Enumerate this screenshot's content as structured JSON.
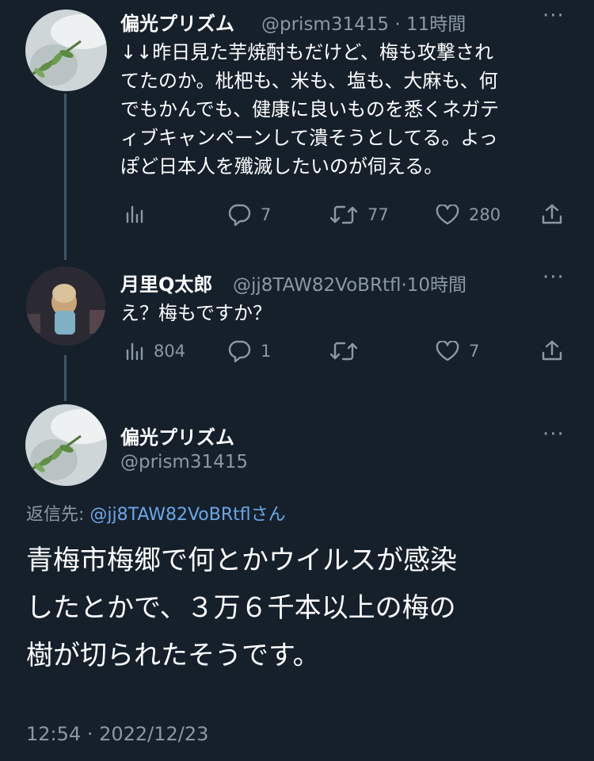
{
  "tweet1": {
    "name": "偏光プリズム",
    "handle": "@prism31415",
    "sep": "·",
    "time": "11時間",
    "lines": [
      "↓↓昨日見た芋焼酎もだけど、梅も攻撃され",
      "てたのか。枇杷も、米も、塩も、大麻も、何",
      "でもかんでも、健康に良いものを悉くネガテ",
      "ィブキャンペーンして潰そうとしてる。よっ",
      "ぽど日本人を殲滅したいのが伺える。"
    ],
    "replies": "7",
    "retweets": "77",
    "likes": "280"
  },
  "tweet2": {
    "name": "月里Q太郎",
    "handle": "@jj8TAW82VoBRtfl",
    "sep": "·",
    "time": "10時間",
    "text": "え？梅もですか？",
    "views": "804",
    "replies": "1",
    "likes": "7"
  },
  "main": {
    "name": "偏光プリズム",
    "handle": "@prism31415",
    "reply_label": "返信先:",
    "reply_target": "@jj8TAW82VoBRtflさん",
    "lines": [
      "青梅市梅郷で何とかウイルスが感染",
      "したとかで、３万６千本以上の梅の",
      "樹が切られたそうです。"
    ],
    "time": "12:54",
    "sep": "·",
    "date": "2022/12/23"
  },
  "colors": {
    "background": "#15202b",
    "secondary": "#8b98a5",
    "link": "#6ca6e8",
    "thread": "#3d5466"
  }
}
